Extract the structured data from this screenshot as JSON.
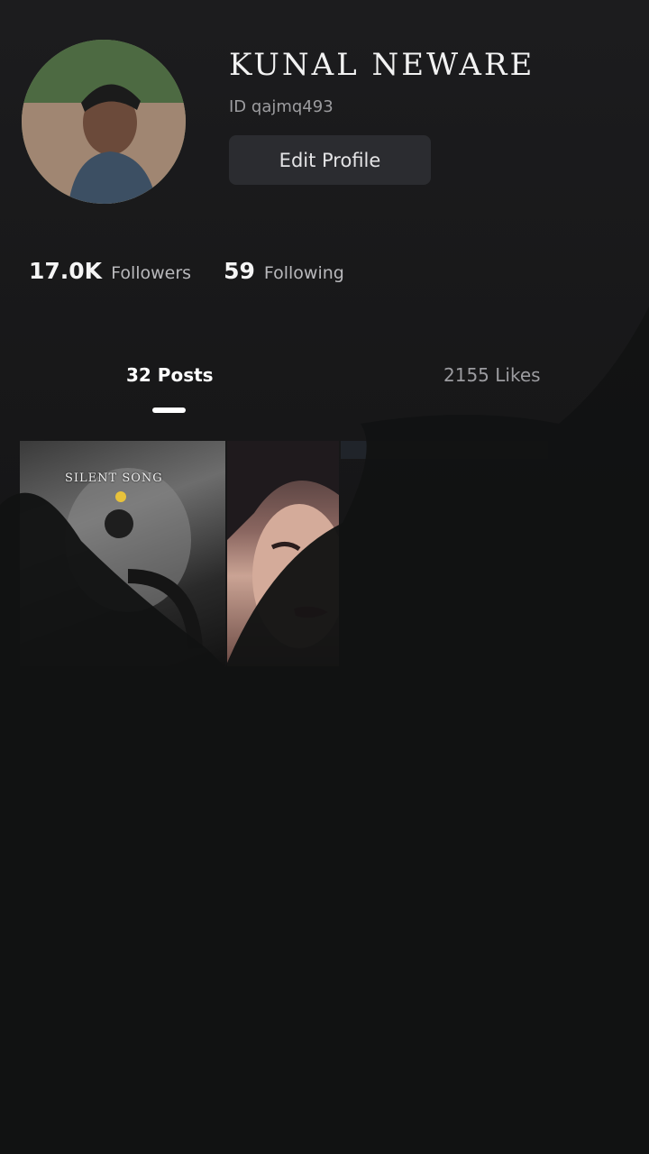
{
  "profile": {
    "display_name": "KUNAL NEWARE",
    "id_text": "ID qajmq493",
    "edit_button_label": "Edit Profile"
  },
  "stats": {
    "followers_count": "17.0K",
    "followers_label": "Followers",
    "following_count": "59",
    "following_label": "Following"
  },
  "tabs": {
    "posts_label": "32 Posts",
    "likes_label": "2155 Likes",
    "active": "posts"
  },
  "posts": [
    {
      "caption": "SILENT SONG",
      "overlay_icon": "emoji-icon"
    },
    {
      "caption": ""
    }
  ],
  "colors": {
    "background": "#1a1a1b",
    "button_bg": "#2b2c30",
    "muted_text": "#9c9ca0"
  }
}
